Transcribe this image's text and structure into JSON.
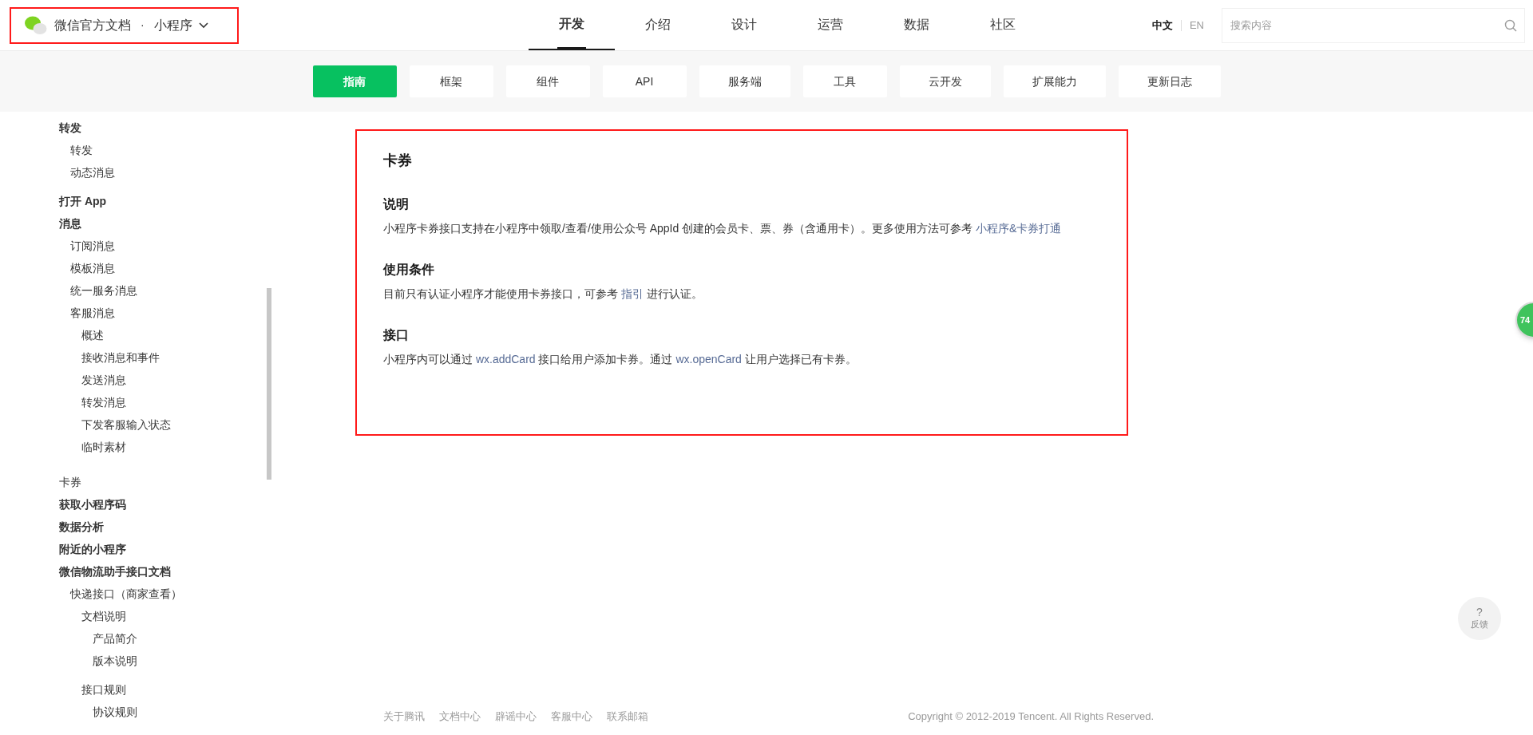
{
  "header": {
    "brand": "微信官方文档",
    "separator": "·",
    "product": "小程序",
    "tabs": [
      {
        "label": "开发",
        "selected": true
      },
      {
        "label": "介绍",
        "selected": false
      },
      {
        "label": "设计",
        "selected": false
      },
      {
        "label": "运营",
        "selected": false
      },
      {
        "label": "数据",
        "selected": false
      },
      {
        "label": "社区",
        "selected": false
      }
    ],
    "languages": [
      {
        "label": "中文",
        "selected": true
      },
      {
        "label": "EN",
        "selected": false
      }
    ],
    "search": {
      "placeholder": "搜索内容"
    }
  },
  "subnav": [
    {
      "label": "指南",
      "selected": true
    },
    {
      "label": "框架",
      "selected": false
    },
    {
      "label": "组件",
      "selected": false
    },
    {
      "label": "API",
      "selected": false
    },
    {
      "label": "服务端",
      "selected": false
    },
    {
      "label": "工具",
      "selected": false
    },
    {
      "label": "云开发",
      "selected": false
    },
    {
      "label": "扩展能力",
      "selected": false
    },
    {
      "label": "更新日志",
      "selected": false
    }
  ],
  "sidebar": {
    "items": [
      {
        "label": "转发",
        "bold": true,
        "children": [
          {
            "label": "转发",
            "bold": false
          },
          {
            "label": "动态消息",
            "bold": false
          }
        ]
      },
      {
        "label": "打开 App",
        "bold": true
      },
      {
        "label": "消息",
        "bold": true,
        "children": [
          {
            "label": "订阅消息",
            "bold": false
          },
          {
            "label": "模板消息",
            "bold": false
          },
          {
            "label": "统一服务消息",
            "bold": false
          },
          {
            "label": "客服消息",
            "bold": false,
            "children": [
              {
                "label": "概述",
                "bold": false
              },
              {
                "label": "接收消息和事件",
                "bold": false
              },
              {
                "label": "发送消息",
                "bold": false
              },
              {
                "label": "转发消息",
                "bold": false
              },
              {
                "label": "下发客服输入状态",
                "bold": false
              },
              {
                "label": "临时素材",
                "bold": false
              }
            ]
          }
        ]
      },
      {
        "label": "卡券",
        "bold": false
      },
      {
        "label": "获取小程序码",
        "bold": true
      },
      {
        "label": "数据分析",
        "bold": true
      },
      {
        "label": "附近的小程序",
        "bold": true
      },
      {
        "label": "微信物流助手接口文档",
        "bold": true,
        "children": [
          {
            "label": "快递接口（商家查看）",
            "bold": false,
            "children": [
              {
                "label": "文档说明",
                "bold": false,
                "children": [
                  {
                    "label": "产品简介",
                    "bold": false
                  },
                  {
                    "label": "版本说明",
                    "bold": false
                  }
                ]
              },
              {
                "label": "接口规则",
                "bold": false,
                "children": [
                  {
                    "label": "协议规则",
                    "bold": false
                  }
                ]
              }
            ]
          }
        ]
      }
    ]
  },
  "article": {
    "title": "卡券",
    "sections": [
      {
        "heading": "说明",
        "paragraph": [
          {
            "kind": "text",
            "text": "小程序卡券接口支持在小程序中领取/查看/使用公众号 AppId 创建的会员卡、票、券（含通用卡）。更多使用方法可参考 "
          },
          {
            "kind": "link",
            "text": "小程序&卡券打通"
          }
        ]
      },
      {
        "heading": "使用条件",
        "paragraph": [
          {
            "kind": "text",
            "text": "目前只有认证小程序才能使用卡券接口，可参考 "
          },
          {
            "kind": "link",
            "text": "指引"
          },
          {
            "kind": "text",
            "text": " 进行认证。"
          }
        ]
      },
      {
        "heading": "接口",
        "paragraph": [
          {
            "kind": "text",
            "text": "小程序内可以通过 "
          },
          {
            "kind": "link",
            "text": "wx.addCard"
          },
          {
            "kind": "text",
            "text": " 接口给用户添加卡券。通过 "
          },
          {
            "kind": "link",
            "text": "wx.openCard"
          },
          {
            "kind": "text",
            "text": " 让用户选择已有卡券。"
          }
        ]
      }
    ]
  },
  "footer": {
    "links": [
      "关于腾讯",
      "文档中心",
      "辟谣中心",
      "客服中心",
      "联系邮箱"
    ],
    "copyright": "Copyright © 2012-2019 Tencent. All Rights Reserved."
  },
  "float_badge": "74",
  "feedback": {
    "icon": "?",
    "label": "反馈"
  }
}
